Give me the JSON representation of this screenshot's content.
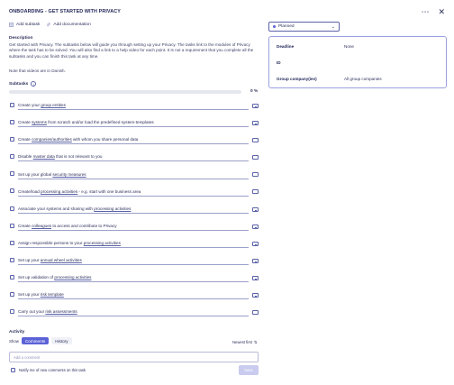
{
  "header": {
    "title": "ONBOARDING - GET STARTED WITH PRIVACY",
    "more_icon": "more-horizontal-icon",
    "close_icon": "close-icon"
  },
  "toolbar": {
    "add_subtask": "Add subtask",
    "add_documentation": "Add documentation"
  },
  "description": {
    "label": "Description",
    "text": "Get started with Privacy. The subtasks below will guide you through setting up your Privacy. The tasks link to the modules of Privacy where the task has to be solved. You will also find a link to a help video for each point. It is not a requirement that you complete all the subtasks and you can finish this task at any time.",
    "note": "Note that videos are in Danish."
  },
  "subtasks": {
    "label": "Subtasks",
    "progress_percent": 0,
    "progress_label": "0 %",
    "items": [
      {
        "pre": "Create your ",
        "link": "group entities",
        "post": ""
      },
      {
        "pre": "Create ",
        "link": "systems",
        "post": " from scratch and/or load the predefined system-templates"
      },
      {
        "pre": "Create ",
        "link": "companies/authorities",
        "post": " with whom you share personal data"
      },
      {
        "pre": "Disable ",
        "link": "master data",
        "post": " that is not relevant to you"
      },
      {
        "pre": "Set up your global ",
        "link": "security measures",
        "post": ""
      },
      {
        "pre": "Create/load ",
        "link": "processing activities",
        "post": " - e.g. start with one business area"
      },
      {
        "pre": "Associate your systems and sharing with ",
        "link": "processing activities",
        "post": ""
      },
      {
        "pre": "Create ",
        "link": "colleagues",
        "post": " to access and contribute to Privacy"
      },
      {
        "pre": "Assign responsible persons to your ",
        "link": "processing activities",
        "post": ""
      },
      {
        "pre": "Set up your ",
        "link": "annual wheel activities",
        "post": ""
      },
      {
        "pre": "Set up validation of ",
        "link": "processing activities",
        "post": ""
      },
      {
        "pre": "Set up your ",
        "link": "risk template",
        "post": ""
      },
      {
        "pre": "Carry out your ",
        "link": "risk assessments",
        "post": ""
      }
    ]
  },
  "activity": {
    "label": "Activity",
    "show_label": "Show",
    "tab_comments": "Comments",
    "tab_history": "History",
    "sort_label": "Newest first",
    "comment_placeholder": "Add a comment",
    "notify_label": "Notify me of new comments on this task",
    "save_label": "Save"
  },
  "status": {
    "value": "Planned",
    "color": "#5b62d6"
  },
  "details": {
    "deadline_label": "Deadline",
    "deadline_value": "None",
    "id_label": "ID",
    "id_value": "",
    "group_label": "Group company(ies)",
    "group_value": "All group companies"
  }
}
